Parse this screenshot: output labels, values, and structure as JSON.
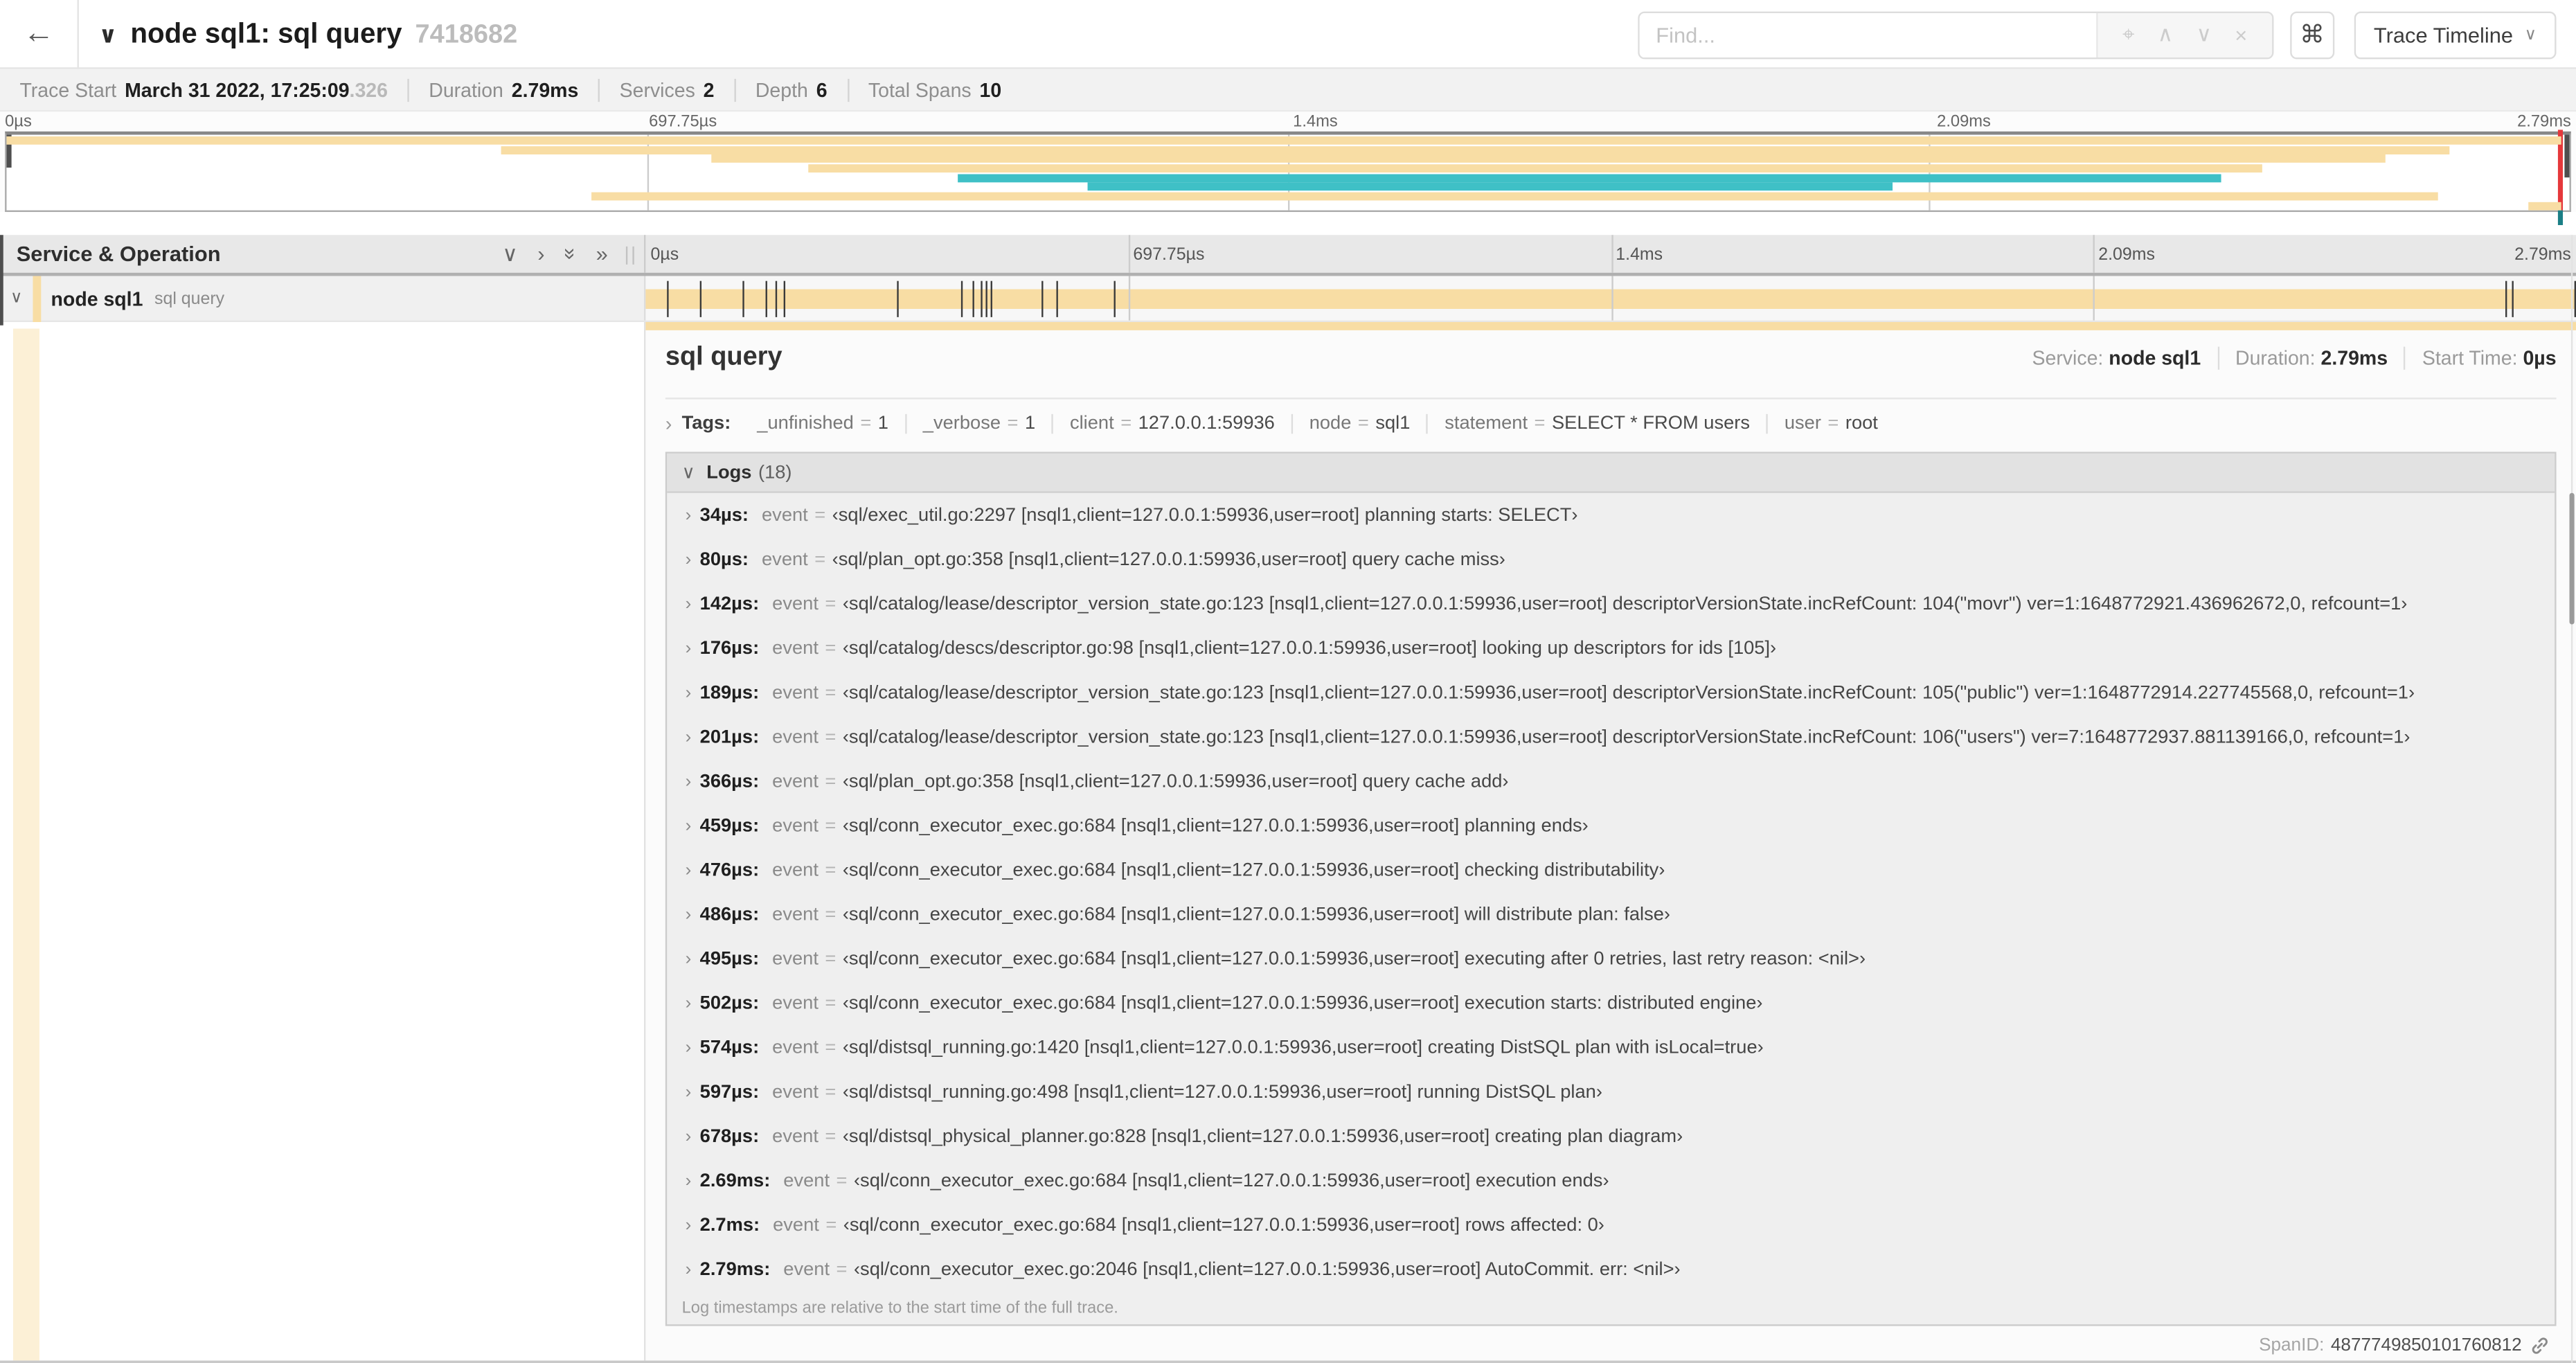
{
  "header": {
    "back_icon": "←",
    "collapse_chevron": "∨",
    "title": "node sql1: sql query",
    "trace_id": "7418682",
    "find_placeholder": "Find...",
    "find_icons": [
      {
        "name": "locate-icon",
        "glyph": "⌖"
      },
      {
        "name": "prev-result-icon",
        "glyph": "∧"
      },
      {
        "name": "next-result-icon",
        "glyph": "∨"
      },
      {
        "name": "clear-find-icon",
        "glyph": "×"
      }
    ],
    "shortcut_key": "⌘",
    "view_dropdown": "Trace Timeline",
    "view_caret": "∨"
  },
  "summary": {
    "items": [
      {
        "label": "Trace Start",
        "value": "March 31 2022, 17:25:09",
        "suffix": ".326"
      },
      {
        "label": "Duration",
        "value": "2.79ms",
        "suffix": ""
      },
      {
        "label": "Services",
        "value": "2",
        "suffix": ""
      },
      {
        "label": "Depth",
        "value": "6",
        "suffix": ""
      },
      {
        "label": "Total Spans",
        "value": "10",
        "suffix": ""
      }
    ]
  },
  "timeline": {
    "duration_us": 2790,
    "axis_ticks": [
      {
        "label": "0µs",
        "pos": 0
      },
      {
        "label": "697.75µs",
        "pos": 0.25
      },
      {
        "label": "1.4ms",
        "pos": 0.5
      },
      {
        "label": "2.09ms",
        "pos": 0.75
      },
      {
        "label": "2.79ms",
        "pos": 1
      }
    ],
    "left_header": "Service & Operation",
    "header_icons": [
      {
        "name": "collapse-one-icon",
        "glyph": "∨",
        "rotate": 0
      },
      {
        "name": "expand-one-icon",
        "glyph": "›",
        "rotate": 0
      },
      {
        "name": "collapse-all-icon",
        "glyph": "»",
        "rotate": 90
      },
      {
        "name": "expand-all-icon",
        "glyph": "»",
        "rotate": 0
      }
    ]
  },
  "minimap": {
    "bars": [
      {
        "row": 0,
        "start": 0.0,
        "end": 0.997,
        "color": "tan"
      },
      {
        "row": 1,
        "start": 0.193,
        "end": 0.953,
        "color": "tan"
      },
      {
        "row": 2,
        "start": 0.275,
        "end": 0.928,
        "color": "tan"
      },
      {
        "row": 3,
        "start": 0.313,
        "end": 0.88,
        "color": "tan"
      },
      {
        "row": 4,
        "start": 0.371,
        "end": 0.864,
        "color": "teal"
      },
      {
        "row": 5,
        "start": 0.422,
        "end": 0.736,
        "color": "teal"
      },
      {
        "row": 6,
        "start": 0.228,
        "end": 0.949,
        "color": "tan"
      },
      {
        "row": 7,
        "start": 0.984,
        "end": 0.997,
        "color": "tan"
      }
    ]
  },
  "span_row": {
    "chevron": "∨",
    "service": "node sql1",
    "operation": "sql query"
  },
  "span_detail": {
    "title": "sql query",
    "service_label": "Service:",
    "service": "node sql1",
    "duration_label": "Duration:",
    "duration": "2.79ms",
    "start_label": "Start Time:",
    "start_time": "0µs",
    "tags_chevron": "›",
    "tags_label": "Tags:",
    "tags": [
      {
        "key": "_unfinished",
        "value": "1"
      },
      {
        "key": "_verbose",
        "value": "1"
      },
      {
        "key": "client",
        "value": "127.0.0.1:59936"
      },
      {
        "key": "node",
        "value": "sql1"
      },
      {
        "key": "statement",
        "value": "SELECT * FROM users"
      },
      {
        "key": "user",
        "value": "root"
      }
    ],
    "logs_chevron": "∨",
    "logs_label": "Logs",
    "logs_count": "(18)",
    "logs": [
      {
        "time": "34µs:",
        "t_us": 34,
        "field": "event",
        "value": "‹sql/exec_util.go:2297 [nsql1,client=127.0.0.1:59936,user=root] planning starts: SELECT›"
      },
      {
        "time": "80µs:",
        "t_us": 80,
        "field": "event",
        "value": "‹sql/plan_opt.go:358 [nsql1,client=127.0.0.1:59936,user=root] query cache miss›"
      },
      {
        "time": "142µs:",
        "t_us": 142,
        "field": "event",
        "value": "‹sql/catalog/lease/descriptor_version_state.go:123 [nsql1,client=127.0.0.1:59936,user=root] descriptorVersionState.incRefCount: 104(\"movr\") ver=1:1648772921.436962672,0, refcount=1›"
      },
      {
        "time": "176µs:",
        "t_us": 176,
        "field": "event",
        "value": "‹sql/catalog/descs/descriptor.go:98 [nsql1,client=127.0.0.1:59936,user=root] looking up descriptors for ids [105]›"
      },
      {
        "time": "189µs:",
        "t_us": 189,
        "field": "event",
        "value": "‹sql/catalog/lease/descriptor_version_state.go:123 [nsql1,client=127.0.0.1:59936,user=root] descriptorVersionState.incRefCount: 105(\"public\") ver=1:1648772914.227745568,0, refcount=1›"
      },
      {
        "time": "201µs:",
        "t_us": 201,
        "field": "event",
        "value": "‹sql/catalog/lease/descriptor_version_state.go:123 [nsql1,client=127.0.0.1:59936,user=root] descriptorVersionState.incRefCount: 106(\"users\") ver=7:1648772937.881139166,0, refcount=1›"
      },
      {
        "time": "366µs:",
        "t_us": 366,
        "field": "event",
        "value": "‹sql/plan_opt.go:358 [nsql1,client=127.0.0.1:59936,user=root] query cache add›"
      },
      {
        "time": "459µs:",
        "t_us": 459,
        "field": "event",
        "value": "‹sql/conn_executor_exec.go:684 [nsql1,client=127.0.0.1:59936,user=root] planning ends›"
      },
      {
        "time": "476µs:",
        "t_us": 476,
        "field": "event",
        "value": "‹sql/conn_executor_exec.go:684 [nsql1,client=127.0.0.1:59936,user=root] checking distributability›"
      },
      {
        "time": "486µs:",
        "t_us": 486,
        "field": "event",
        "value": "‹sql/conn_executor_exec.go:684 [nsql1,client=127.0.0.1:59936,user=root] will distribute plan: false›"
      },
      {
        "time": "495µs:",
        "t_us": 495,
        "field": "event",
        "value": "‹sql/conn_executor_exec.go:684 [nsql1,client=127.0.0.1:59936,user=root] executing after 0 retries, last retry reason: <nil>›"
      },
      {
        "time": "502µs:",
        "t_us": 502,
        "field": "event",
        "value": "‹sql/conn_executor_exec.go:684 [nsql1,client=127.0.0.1:59936,user=root] execution starts: distributed engine›"
      },
      {
        "time": "574µs:",
        "t_us": 574,
        "field": "event",
        "value": "‹sql/distsql_running.go:1420 [nsql1,client=127.0.0.1:59936,user=root] creating DistSQL plan with isLocal=true›"
      },
      {
        "time": "597µs:",
        "t_us": 597,
        "field": "event",
        "value": "‹sql/distsql_running.go:498 [nsql1,client=127.0.0.1:59936,user=root] running DistSQL plan›"
      },
      {
        "time": "678µs:",
        "t_us": 678,
        "field": "event",
        "value": "‹sql/distsql_physical_planner.go:828 [nsql1,client=127.0.0.1:59936,user=root] creating plan diagram›"
      },
      {
        "time": "2.69ms:",
        "t_us": 2690,
        "field": "event",
        "value": "‹sql/conn_executor_exec.go:684 [nsql1,client=127.0.0.1:59936,user=root] execution ends›"
      },
      {
        "time": "2.7ms:",
        "t_us": 2700,
        "field": "event",
        "value": "‹sql/conn_executor_exec.go:684 [nsql1,client=127.0.0.1:59936,user=root] rows affected: 0›"
      },
      {
        "time": "2.79ms:",
        "t_us": 2790,
        "field": "event",
        "value": "‹sql/conn_executor_exec.go:2046 [nsql1,client=127.0.0.1:59936,user=root] AutoCommit. err: <nil>›"
      }
    ],
    "footnote": "Log timestamps are relative to the start time of the full trace.",
    "span_id_label": "SpanID:",
    "span_id": "4877749850101760812"
  },
  "colors": {
    "span_tan": "#f8dda4",
    "span_teal": "#3fc0c6",
    "marker_red": "#e5383b",
    "marker_teal_tip": "#1b7f86"
  }
}
